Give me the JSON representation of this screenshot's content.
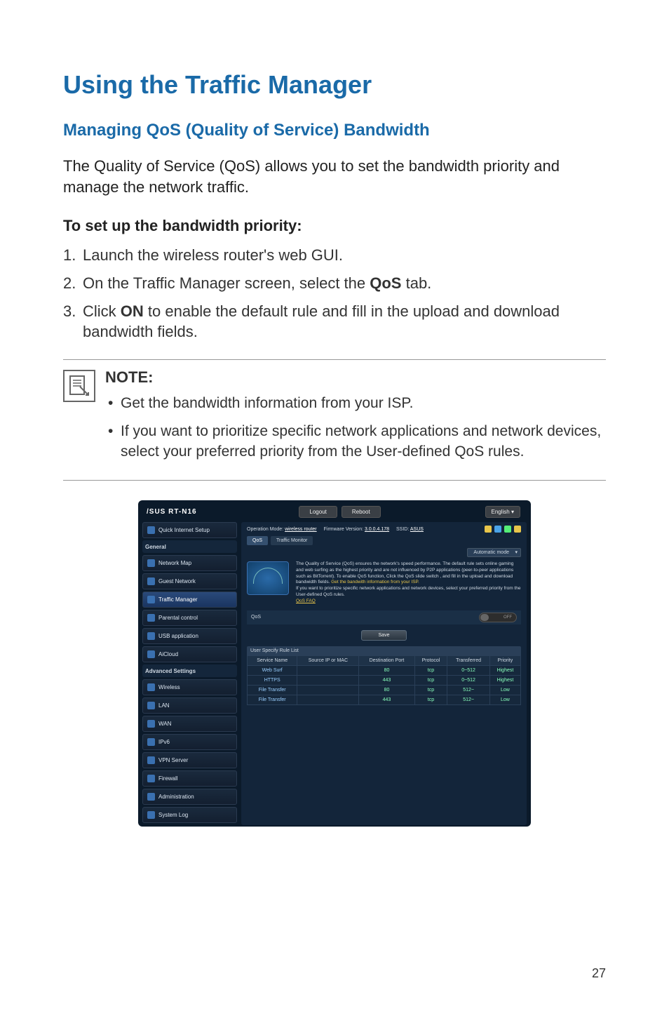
{
  "page_number": "27",
  "h1": "Using the Traffic Manager",
  "h2": "Managing QoS (Quality of Service) Bandwidth",
  "intro": "The Quality of Service (QoS) allows you to set the bandwidth priority and manage the network traffic.",
  "steps_title": "To set up the bandwidth priority:",
  "steps": [
    {
      "num": "1.",
      "text_a": "Launch the wireless router's web GUI.",
      "bold": "",
      "text_b": ""
    },
    {
      "num": "2.",
      "text_a": "On the Traffic Manager screen, select the ",
      "bold": "QoS",
      "text_b": " tab."
    },
    {
      "num": "3.",
      "text_a": "Click ",
      "bold": "ON",
      "text_b": " to enable the default rule and fill in the upload and download bandwidth fields."
    }
  ],
  "note_title": "NOTE:",
  "notes": [
    "Get the bandwidth information from your ISP.",
    "If you want to prioritize specific network applications and network devices, select your preferred priority from the User-defined QoS rules."
  ],
  "router": {
    "brand_model": "/SUS RT-N16",
    "logout": "Logout",
    "reboot": "Reboot",
    "lang": "English",
    "op_mode_label": "Operation Mode:",
    "op_mode_value": "wireless router",
    "fw_label": "Firmware Version:",
    "fw_value": "3.0.0.4.178",
    "ssid_label": "SSID:",
    "ssid_value": "ASUS",
    "tabs": [
      "QoS",
      "Traffic Monitor"
    ],
    "mode_select": "Automatic mode",
    "sidebar_quick": "Quick Internet Setup",
    "sidebar_sections": [
      "General",
      "Advanced Settings"
    ],
    "sidebar_general": [
      "Network Map",
      "Guest Network",
      "Traffic Manager",
      "Parental control",
      "USB application",
      "AiCloud"
    ],
    "sidebar_advanced": [
      "Wireless",
      "LAN",
      "WAN",
      "IPv6",
      "VPN Server",
      "Firewall",
      "Administration",
      "System Log"
    ],
    "desc_1": "The Quality of Service (QoS) ensures the network's speed performance. The default rule sets online gaming and web surfing as the highest priority and are not influenced by P2P applications (peer-to-peer applications such as BitTorrent). To enable QoS function, Click the QoS slide switch , and fill in the upload and download bandwidth fields. ",
    "desc_yellow": "Get the bandwith information from your ISP.",
    "desc_2": "If you want to prioritize specific network applications and network devices, select your preferred priority from the User-defined QoS rules.",
    "faq": "QoS FAQ",
    "qos_label": "QoS",
    "qos_state": "OFF",
    "save": "Save",
    "table_title": "User Specify Rule List",
    "columns": [
      "Service Name",
      "Source IP or MAC",
      "Destination Port",
      "Protocol",
      "Transferred",
      "Priority"
    ],
    "rows": [
      {
        "name": "Web Surf",
        "src": "",
        "port": "80",
        "proto": "tcp",
        "trans": "0~512",
        "prio": "Highest"
      },
      {
        "name": "HTTPS",
        "src": "",
        "port": "443",
        "proto": "tcp",
        "trans": "0~512",
        "prio": "Highest"
      },
      {
        "name": "File Transfer",
        "src": "",
        "port": "80",
        "proto": "tcp",
        "trans": "512~",
        "prio": "Low"
      },
      {
        "name": "File Transfer",
        "src": "",
        "port": "443",
        "proto": "tcp",
        "trans": "512~",
        "prio": "Low"
      }
    ]
  }
}
